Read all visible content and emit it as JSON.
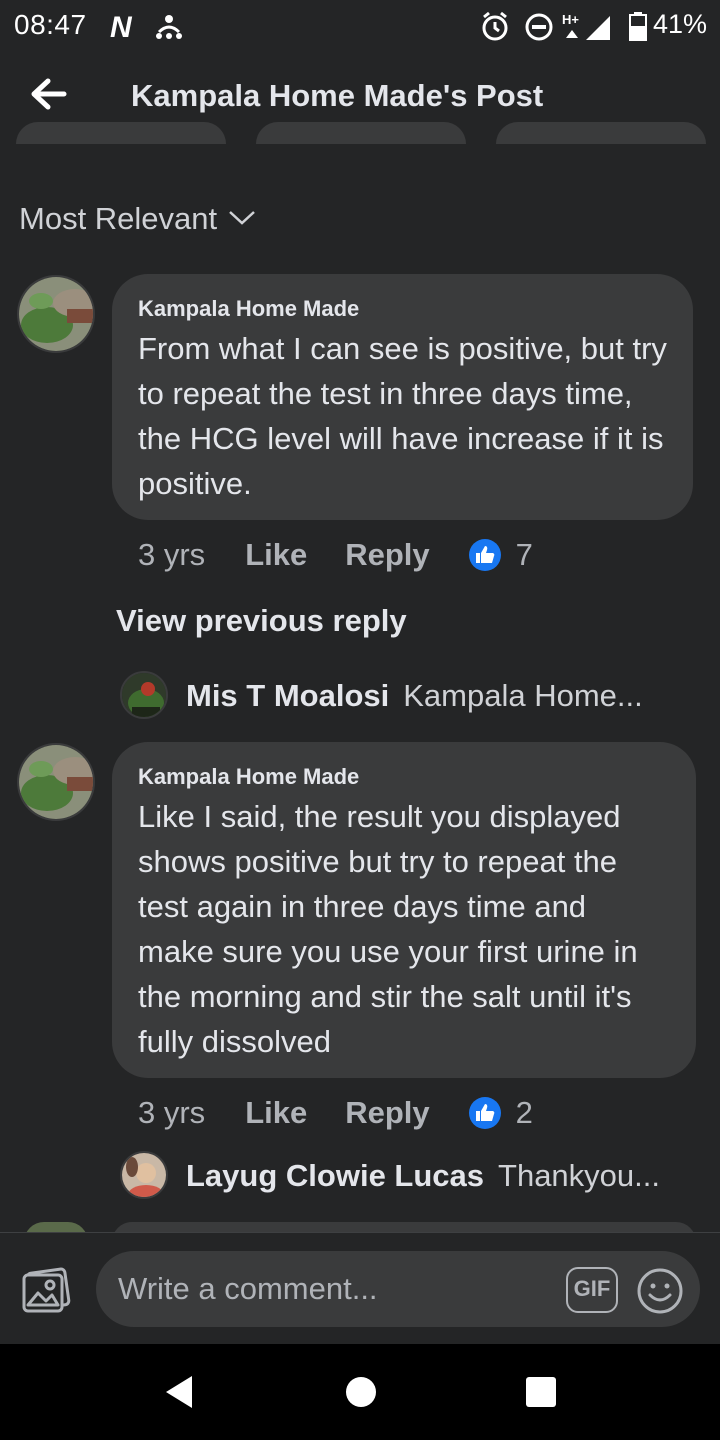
{
  "status_bar": {
    "time": "08:47",
    "battery": "41%"
  },
  "header": {
    "title": "Kampala Home Made's Post"
  },
  "sort": {
    "label": "Most Relevant"
  },
  "comments": [
    {
      "author": "Kampala Home Made",
      "text": "From what I can see is positive, but try to repeat the test in three days time, the HCG level will have increase if it is positive.",
      "age": "3 yrs",
      "like_label": "Like",
      "reply_label": "Reply",
      "like_count": "7"
    },
    {
      "author": "Kampala Home Made",
      "text": "Like I said, the result you displayed shows positive but try to repeat the test again in three days time and make sure you use your first urine in the morning and stir the salt until it's fully dissolved",
      "age": "3 yrs",
      "like_label": "Like",
      "reply_label": "Reply",
      "like_count": "2"
    }
  ],
  "view_previous": "View previous reply",
  "replies": [
    {
      "name": "Mis T Moalosi",
      "preview": "Kampala Home..."
    },
    {
      "name": "Layug Clowie Lucas",
      "preview": "Thankyou..."
    }
  ],
  "composer": {
    "placeholder": "Write a comment...",
    "gif_label": "GIF"
  },
  "colors": {
    "background": "#242526",
    "bubble": "#3a3b3c",
    "like_blue": "#1877f2"
  }
}
